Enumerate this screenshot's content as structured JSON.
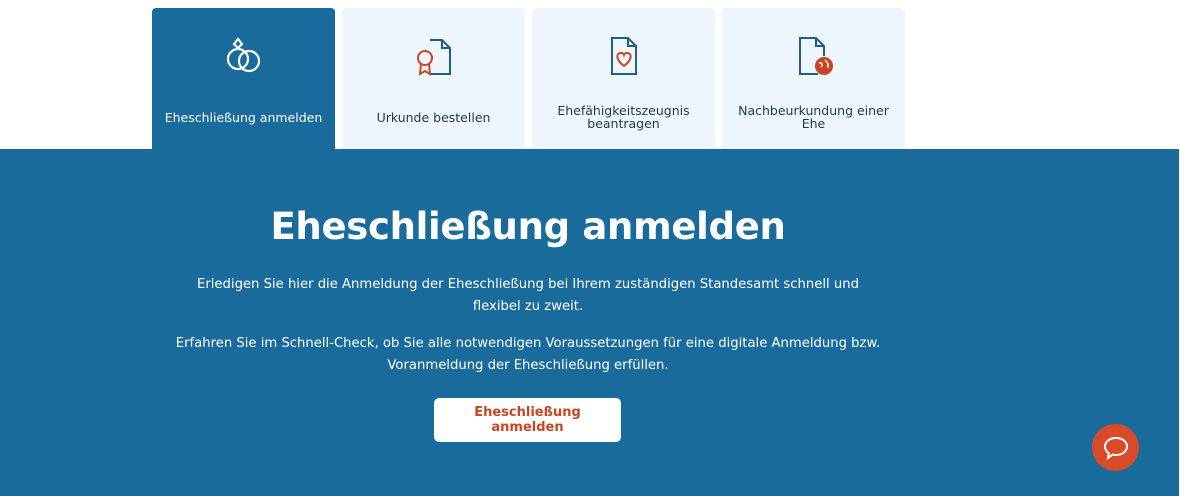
{
  "tabs": [
    {
      "label": "Eheschließung anmelden",
      "icon": "rings-icon",
      "active": true
    },
    {
      "label": "Urkunde bestellen",
      "icon": "certificate-document-icon",
      "active": false
    },
    {
      "label": "Ehefähigkeitszeugnis beantragen",
      "icon": "heart-document-icon",
      "active": false
    },
    {
      "label": "Nachbeurkundung einer Ehe",
      "icon": "globe-document-icon",
      "active": false
    }
  ],
  "main": {
    "title": "Eheschließung anmelden",
    "paragraph1": "Erledigen Sie hier die Anmeldung der Eheschließung bei Ihrem zuständigen Standesamt schnell und flexibel zu zweit.",
    "paragraph2": "Erfahren Sie im Schnell-Check, ob Sie alle notwendigen Voraussetzungen für eine digitale Anmeldung bzw. Vor­anmeldung der Eheschließung erfüllen.",
    "cta_label": "Eheschließung anmelden"
  },
  "chat": {
    "icon": "chat-bubble-icon"
  },
  "colors": {
    "primary": "#186b9b",
    "tab_inactive": "#eef6fd",
    "accent": "#d94a2b",
    "cta_text": "#c84523"
  }
}
